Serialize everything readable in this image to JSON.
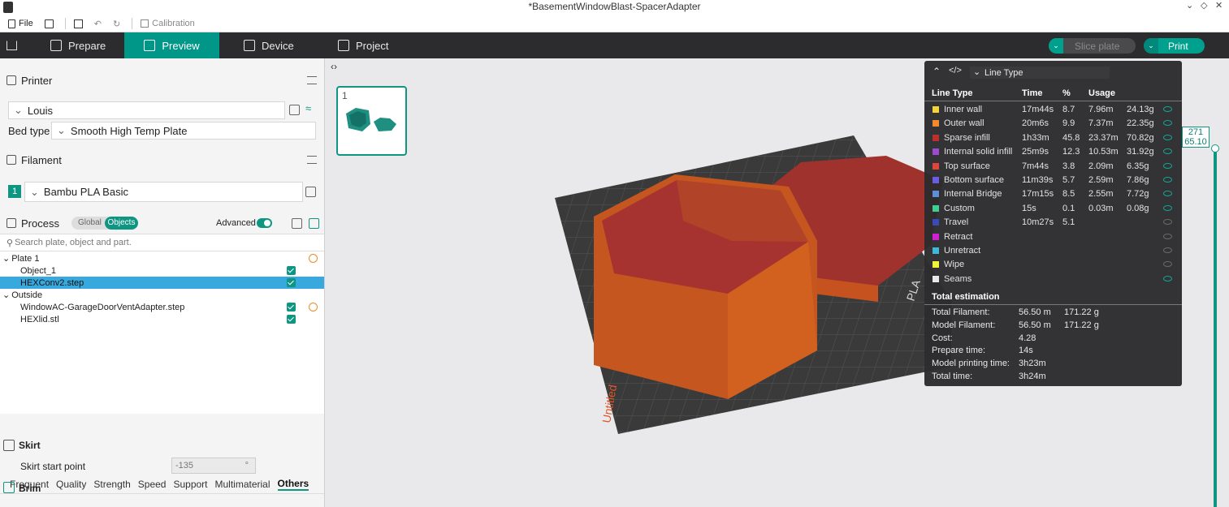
{
  "window": {
    "title": "*BasementWindowBlast-SpacerAdapter"
  },
  "toolbar": {
    "file_label": "File",
    "calibration_label": "Calibration"
  },
  "nav": {
    "tabs": [
      {
        "label": "Prepare"
      },
      {
        "label": "Preview"
      },
      {
        "label": "Device"
      },
      {
        "label": "Project"
      }
    ],
    "slice_label": "Slice plate",
    "print_label": "Print"
  },
  "printer": {
    "section_label": "Printer",
    "name": "Louis",
    "bed_type_label": "Bed type",
    "bed_type_value": "Smooth High Temp Plate"
  },
  "filament": {
    "section_label": "Filament",
    "slot": "1",
    "name": "Bambu PLA Basic"
  },
  "process": {
    "section_label": "Process",
    "global_label": "Global",
    "objects_label": "Objects",
    "advanced_label": "Advanced",
    "search_placeholder": "Search plate, object and part."
  },
  "objects": {
    "rows": [
      {
        "label": "Plate 1"
      },
      {
        "label": "Object_1"
      },
      {
        "label": "HEXConv2.step"
      },
      {
        "label": "Outside"
      },
      {
        "label": "WindowAC-GarageDoorVentAdapter.step"
      },
      {
        "label": "HEXlid.stl"
      }
    ]
  },
  "settings_tabs": [
    "Frequent",
    "Quality",
    "Strength",
    "Speed",
    "Support",
    "Multimaterial",
    "Others"
  ],
  "settings": {
    "skirt_heading": "Skirt",
    "skirt_start_label": "Skirt start point",
    "skirt_start_value": "-135",
    "skirt_start_unit": "°",
    "brim_heading": "Brim"
  },
  "plate_thumb": {
    "number": "1"
  },
  "legend": {
    "dropdown_label": "Line Type",
    "headers": {
      "type": "Line Type",
      "time": "Time",
      "pct": "%",
      "usage": "Usage"
    },
    "rows": [
      {
        "name": "Inner wall",
        "color": "#f5d33a",
        "time": "17m44s",
        "pct": "8.7",
        "len": "7.96m",
        "weight": "24.13g",
        "visible": true
      },
      {
        "name": "Outer wall",
        "color": "#f28b30",
        "time": "20m6s",
        "pct": "9.9",
        "len": "7.37m",
        "weight": "22.35g",
        "visible": true
      },
      {
        "name": "Sparse infill",
        "color": "#b8312f",
        "time": "1h33m",
        "pct": "45.8",
        "len": "23.37m",
        "weight": "70.82g",
        "visible": true
      },
      {
        "name": "Internal solid infill",
        "color": "#9c4bd1",
        "time": "25m9s",
        "pct": "12.3",
        "len": "10.53m",
        "weight": "31.92g",
        "visible": true
      },
      {
        "name": "Top surface",
        "color": "#e0443d",
        "time": "7m44s",
        "pct": "3.8",
        "len": "2.09m",
        "weight": "6.35g",
        "visible": true
      },
      {
        "name": "Bottom surface",
        "color": "#6b5de3",
        "time": "11m39s",
        "pct": "5.7",
        "len": "2.59m",
        "weight": "7.86g",
        "visible": true
      },
      {
        "name": "Internal Bridge",
        "color": "#5d8fd6",
        "time": "17m15s",
        "pct": "8.5",
        "len": "2.55m",
        "weight": "7.72g",
        "visible": true
      },
      {
        "name": "Custom",
        "color": "#3fcf8e",
        "time": "15s",
        "pct": "0.1",
        "len": "0.03m",
        "weight": "0.08g",
        "visible": true
      },
      {
        "name": "Travel",
        "color": "#3b4bb5",
        "time": "10m27s",
        "pct": "5.1",
        "len": "",
        "weight": "",
        "visible": false
      },
      {
        "name": "Retract",
        "color": "#d21fd1",
        "time": "",
        "pct": "",
        "len": "",
        "weight": "",
        "visible": false
      },
      {
        "name": "Unretract",
        "color": "#3fb8d8",
        "time": "",
        "pct": "",
        "len": "",
        "weight": "",
        "visible": false
      },
      {
        "name": "Wipe",
        "color": "#f5f23a",
        "time": "",
        "pct": "",
        "len": "",
        "weight": "",
        "visible": false
      },
      {
        "name": "Seams",
        "color": "#e8e8e8",
        "time": "",
        "pct": "",
        "len": "",
        "weight": "",
        "visible": true
      }
    ],
    "total_heading": "Total estimation",
    "totals": [
      {
        "label": "Total Filament:",
        "a": "56.50 m",
        "b": "171.22 g"
      },
      {
        "label": "Model Filament:",
        "a": "56.50 m",
        "b": "171.22 g"
      },
      {
        "label": "Cost:",
        "a": "4.28",
        "b": ""
      },
      {
        "label": "Prepare time:",
        "a": "14s",
        "b": ""
      },
      {
        "label": "Model printing time:",
        "a": "3h23m",
        "b": ""
      },
      {
        "label": "Total time:",
        "a": "3h24m",
        "b": ""
      }
    ]
  },
  "layer_slider": {
    "layer": "271",
    "height": "65.10"
  },
  "bed": {
    "label_side": "PLA",
    "label_front": "Untitled"
  }
}
